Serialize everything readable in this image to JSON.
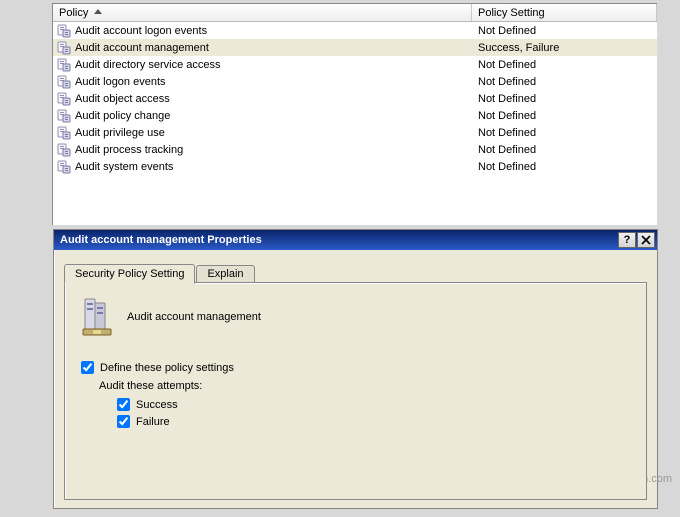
{
  "list": {
    "headers": {
      "policy": "Policy",
      "setting": "Policy Setting"
    },
    "rows": [
      {
        "name": "Audit account logon events",
        "setting": "Not Defined",
        "selected": false
      },
      {
        "name": "Audit account management",
        "setting": "Success, Failure",
        "selected": true
      },
      {
        "name": "Audit directory service access",
        "setting": "Not Defined",
        "selected": false
      },
      {
        "name": "Audit logon events",
        "setting": "Not Defined",
        "selected": false
      },
      {
        "name": "Audit object access",
        "setting": "Not Defined",
        "selected": false
      },
      {
        "name": "Audit policy change",
        "setting": "Not Defined",
        "selected": false
      },
      {
        "name": "Audit privilege use",
        "setting": "Not Defined",
        "selected": false
      },
      {
        "name": "Audit process tracking",
        "setting": "Not Defined",
        "selected": false
      },
      {
        "name": "Audit system events",
        "setting": "Not Defined",
        "selected": false
      }
    ]
  },
  "dialog": {
    "title": "Audit account management Properties",
    "help_btn": "?",
    "close_btn": "✕",
    "tabs": {
      "active": "Security Policy Setting",
      "other": "Explain"
    },
    "policy_name": "Audit account management",
    "define_label": "Define these policy settings",
    "define_checked": true,
    "audit_label": "Audit these attempts:",
    "success_label": "Success",
    "success_checked": true,
    "failure_label": "Failure",
    "failure_checked": true
  },
  "watermark": "wsxdn.com"
}
